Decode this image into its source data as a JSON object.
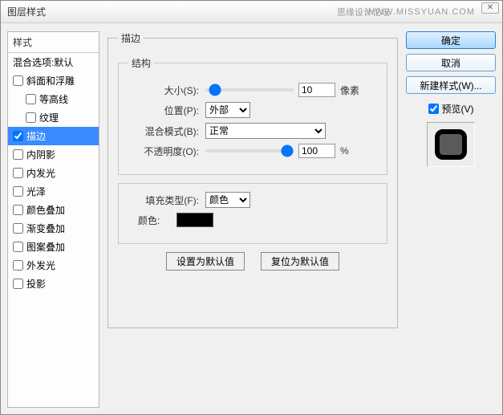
{
  "title": "图层样式",
  "watermark": "WWW.MISSYUAN.COM",
  "watermark2": "思缘设计论坛",
  "sidebar": {
    "header": "样式",
    "default": "混合选项:默认",
    "items": [
      {
        "label": "斜面和浮雕"
      },
      {
        "label": "等高线"
      },
      {
        "label": "纹理"
      },
      {
        "label": "描边"
      },
      {
        "label": "内阴影"
      },
      {
        "label": "内发光"
      },
      {
        "label": "光泽"
      },
      {
        "label": "颜色叠加"
      },
      {
        "label": "渐变叠加"
      },
      {
        "label": "图案叠加"
      },
      {
        "label": "外发光"
      },
      {
        "label": "投影"
      }
    ]
  },
  "stroke": {
    "title": "描边",
    "structure": {
      "title": "结构",
      "size_label": "大小(S):",
      "size_value": "10",
      "size_unit": "像素",
      "position_label": "位置(P):",
      "position_value": "外部",
      "blend_label": "混合模式(B):",
      "blend_value": "正常",
      "opacity_label": "不透明度(O):",
      "opacity_value": "100",
      "opacity_unit": "%"
    },
    "fill": {
      "title_label": "填充类型(F):",
      "type_value": "颜色",
      "color_label": "颜色:",
      "color_value": "#000000"
    },
    "reset_default": "设置为默认值",
    "restore_default": "复位为默认值"
  },
  "right": {
    "ok": "确定",
    "cancel": "取消",
    "newstyle": "新建样式(W)...",
    "preview": "预览(V)"
  }
}
